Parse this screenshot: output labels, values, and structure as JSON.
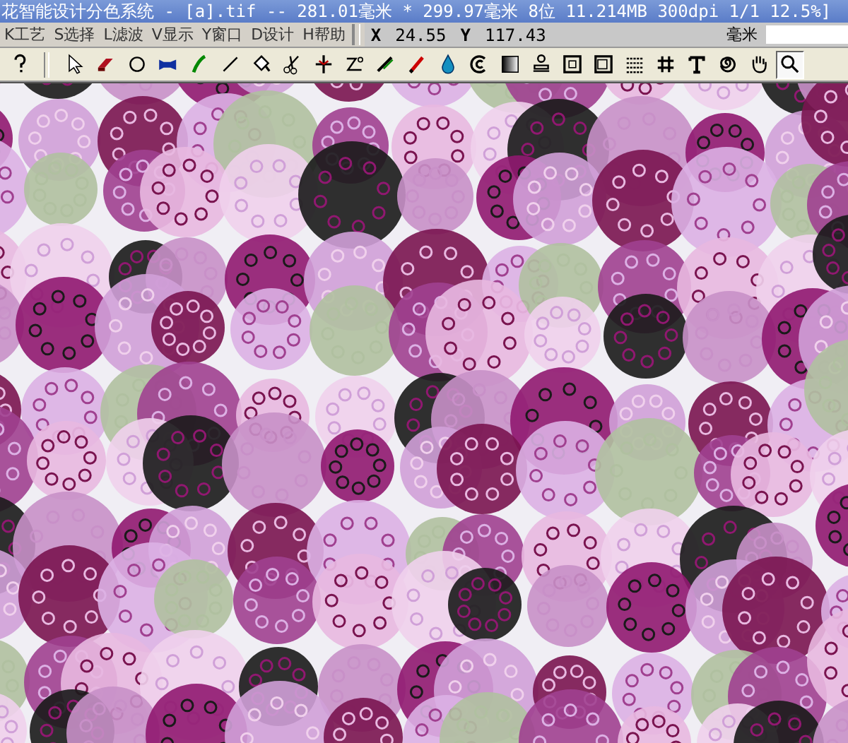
{
  "window": {
    "title": "花智能设计分色系统 - [a].tif -- 281.01毫米 * 299.97毫米 8位  11.214MB 300dpi 1/1  12.5%]"
  },
  "menu": [
    {
      "label": "K工艺"
    },
    {
      "label": "S选择"
    },
    {
      "label": "L滤波"
    },
    {
      "label": "V显示"
    },
    {
      "label": "Y窗口"
    },
    {
      "label": "D设计"
    },
    {
      "label": "H帮助"
    }
  ],
  "coordinates": {
    "x_label": "X",
    "x_value": "24.55",
    "y_label": "Y",
    "y_value": "117.43",
    "unit": "毫米"
  },
  "tools": [
    {
      "kind": "help",
      "selected": false
    },
    {
      "kind": "pointer",
      "selected": false
    },
    {
      "kind": "eraser",
      "selected": false
    },
    {
      "kind": "circle",
      "selected": false
    },
    {
      "kind": "blob",
      "selected": false
    },
    {
      "kind": "pen",
      "selected": false
    },
    {
      "kind": "line",
      "selected": false
    },
    {
      "kind": "bucket",
      "selected": false
    },
    {
      "kind": "scissors",
      "selected": false
    },
    {
      "kind": "cross",
      "selected": false
    },
    {
      "kind": "curve",
      "selected": false
    },
    {
      "kind": "knife",
      "selected": false
    },
    {
      "kind": "brush",
      "selected": false
    },
    {
      "kind": "drop",
      "selected": false
    },
    {
      "kind": "swirl",
      "selected": false
    },
    {
      "kind": "gradient",
      "selected": false
    },
    {
      "kind": "stamp",
      "selected": false
    },
    {
      "kind": "frame",
      "selected": false
    },
    {
      "kind": "frame2",
      "selected": false
    },
    {
      "kind": "dots",
      "selected": false
    },
    {
      "kind": "grid",
      "selected": false
    },
    {
      "kind": "text",
      "selected": false
    },
    {
      "kind": "spiral",
      "selected": false
    },
    {
      "kind": "hand",
      "selected": false
    },
    {
      "kind": "zoom",
      "selected": true
    }
  ]
}
